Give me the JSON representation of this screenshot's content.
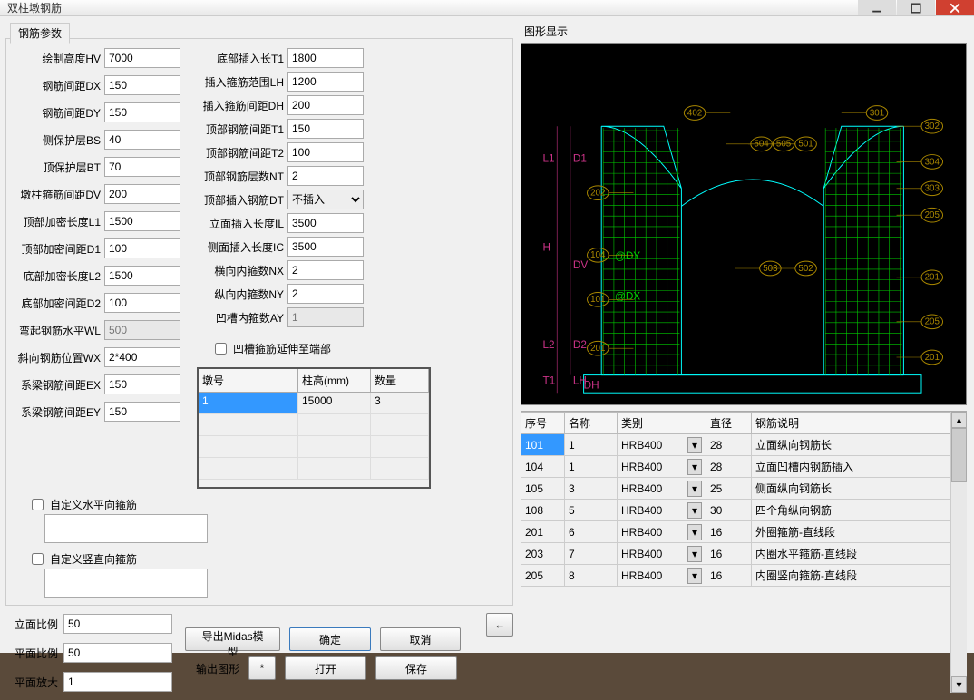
{
  "window": {
    "title": "双柱墩钢筋"
  },
  "tabs": {
    "params": "钢筋参数"
  },
  "left_params": [
    {
      "label": "绘制高度HV",
      "value": "7000"
    },
    {
      "label": "钢筋间距DX",
      "value": "150"
    },
    {
      "label": "钢筋间距DY",
      "value": "150"
    },
    {
      "label": "侧保护层BS",
      "value": "40"
    },
    {
      "label": "顶保护层BT",
      "value": "70"
    },
    {
      "label": "墩柱箍筋间距DV",
      "value": "200"
    },
    {
      "label": "顶部加密长度L1",
      "value": "1500"
    },
    {
      "label": "顶部加密间距D1",
      "value": "100"
    },
    {
      "label": "底部加密长度L2",
      "value": "1500"
    },
    {
      "label": "底部加密间距D2",
      "value": "100"
    },
    {
      "label": "弯起钢筋水平WL",
      "value": "500",
      "disabled": true
    },
    {
      "label": "斜向钢筋位置WX",
      "value": "2*400"
    },
    {
      "label": "系梁钢筋间距EX",
      "value": "150"
    },
    {
      "label": "系梁钢筋间距EY",
      "value": "150"
    }
  ],
  "right_params": [
    {
      "label": "底部插入长T1",
      "value": "1800"
    },
    {
      "label": "插入箍筋范围LH",
      "value": "1200"
    },
    {
      "label": "插入箍筋间距DH",
      "value": "200"
    },
    {
      "label": "顶部钢筋间距T1",
      "value": "150"
    },
    {
      "label": "顶部钢筋间距T2",
      "value": "100"
    },
    {
      "label": "顶部钢筋层数NT",
      "value": "2"
    },
    {
      "label": "顶部插入钢筋DT",
      "type": "select",
      "value": "不插入"
    },
    {
      "label": "立面插入长度IL",
      "value": "3500"
    },
    {
      "label": "侧面插入长度IC",
      "value": "3500"
    },
    {
      "label": "横向内箍数NX",
      "value": "2"
    },
    {
      "label": "纵向内箍数NY",
      "value": "2"
    },
    {
      "label": "凹槽内箍数AY",
      "value": "1",
      "disabled": true
    }
  ],
  "checks": {
    "custom_h": "自定义水平向箍筋",
    "custom_v": "自定义竖直向箍筋",
    "groove_ext": "凹槽箍筋延伸至端部"
  },
  "pier_table": {
    "headers": [
      "墩号",
      "柱高(mm)",
      "数量"
    ],
    "rows": [
      [
        "1",
        "15000",
        "3"
      ]
    ]
  },
  "scales": {
    "elev_label": "立面比例",
    "elev_value": "50",
    "plan_label": "平面比例",
    "plan_value": "50",
    "zoom_label": "平面放大",
    "zoom_value": "1"
  },
  "buttons": {
    "export_midas": "导出Midas模型",
    "ok": "确定",
    "cancel": "取消",
    "out_graph": "输出图形",
    "star": "*",
    "open": "打开",
    "save": "保存",
    "arrow": "←"
  },
  "graph": {
    "title": "图形显示",
    "tags": [
      "402",
      "504",
      "505",
      "501",
      "301",
      "302",
      "304",
      "303",
      "205",
      "202",
      "104",
      "503",
      "502",
      "201",
      "101",
      "201",
      "205",
      "201",
      "201"
    ],
    "dims": [
      "L1",
      "D1",
      "H",
      "DV",
      "L2",
      "D2",
      "T1",
      "LH",
      "DH",
      "@DY",
      "@DX"
    ]
  },
  "rebar_table": {
    "headers": [
      "序号",
      "名称",
      "类别",
      "直径",
      "钢筋说明"
    ],
    "rows": [
      {
        "no": "101",
        "name": "1",
        "type": "HRB400",
        "dia": "28",
        "desc": "立面纵向钢筋长"
      },
      {
        "no": "104",
        "name": "1",
        "type": "HRB400",
        "dia": "28",
        "desc": "立面凹槽内钢筋插入"
      },
      {
        "no": "105",
        "name": "3",
        "type": "HRB400",
        "dia": "25",
        "desc": "侧面纵向钢筋长"
      },
      {
        "no": "108",
        "name": "5",
        "type": "HRB400",
        "dia": "30",
        "desc": "四个角纵向钢筋"
      },
      {
        "no": "201",
        "name": "6",
        "type": "HRB400",
        "dia": "16",
        "desc": "外圈箍筋-直线段"
      },
      {
        "no": "203",
        "name": "7",
        "type": "HRB400",
        "dia": "16",
        "desc": "内圈水平箍筋-直线段"
      },
      {
        "no": "205",
        "name": "8",
        "type": "HRB400",
        "dia": "16",
        "desc": "内圈竖向箍筋-直线段"
      }
    ]
  }
}
